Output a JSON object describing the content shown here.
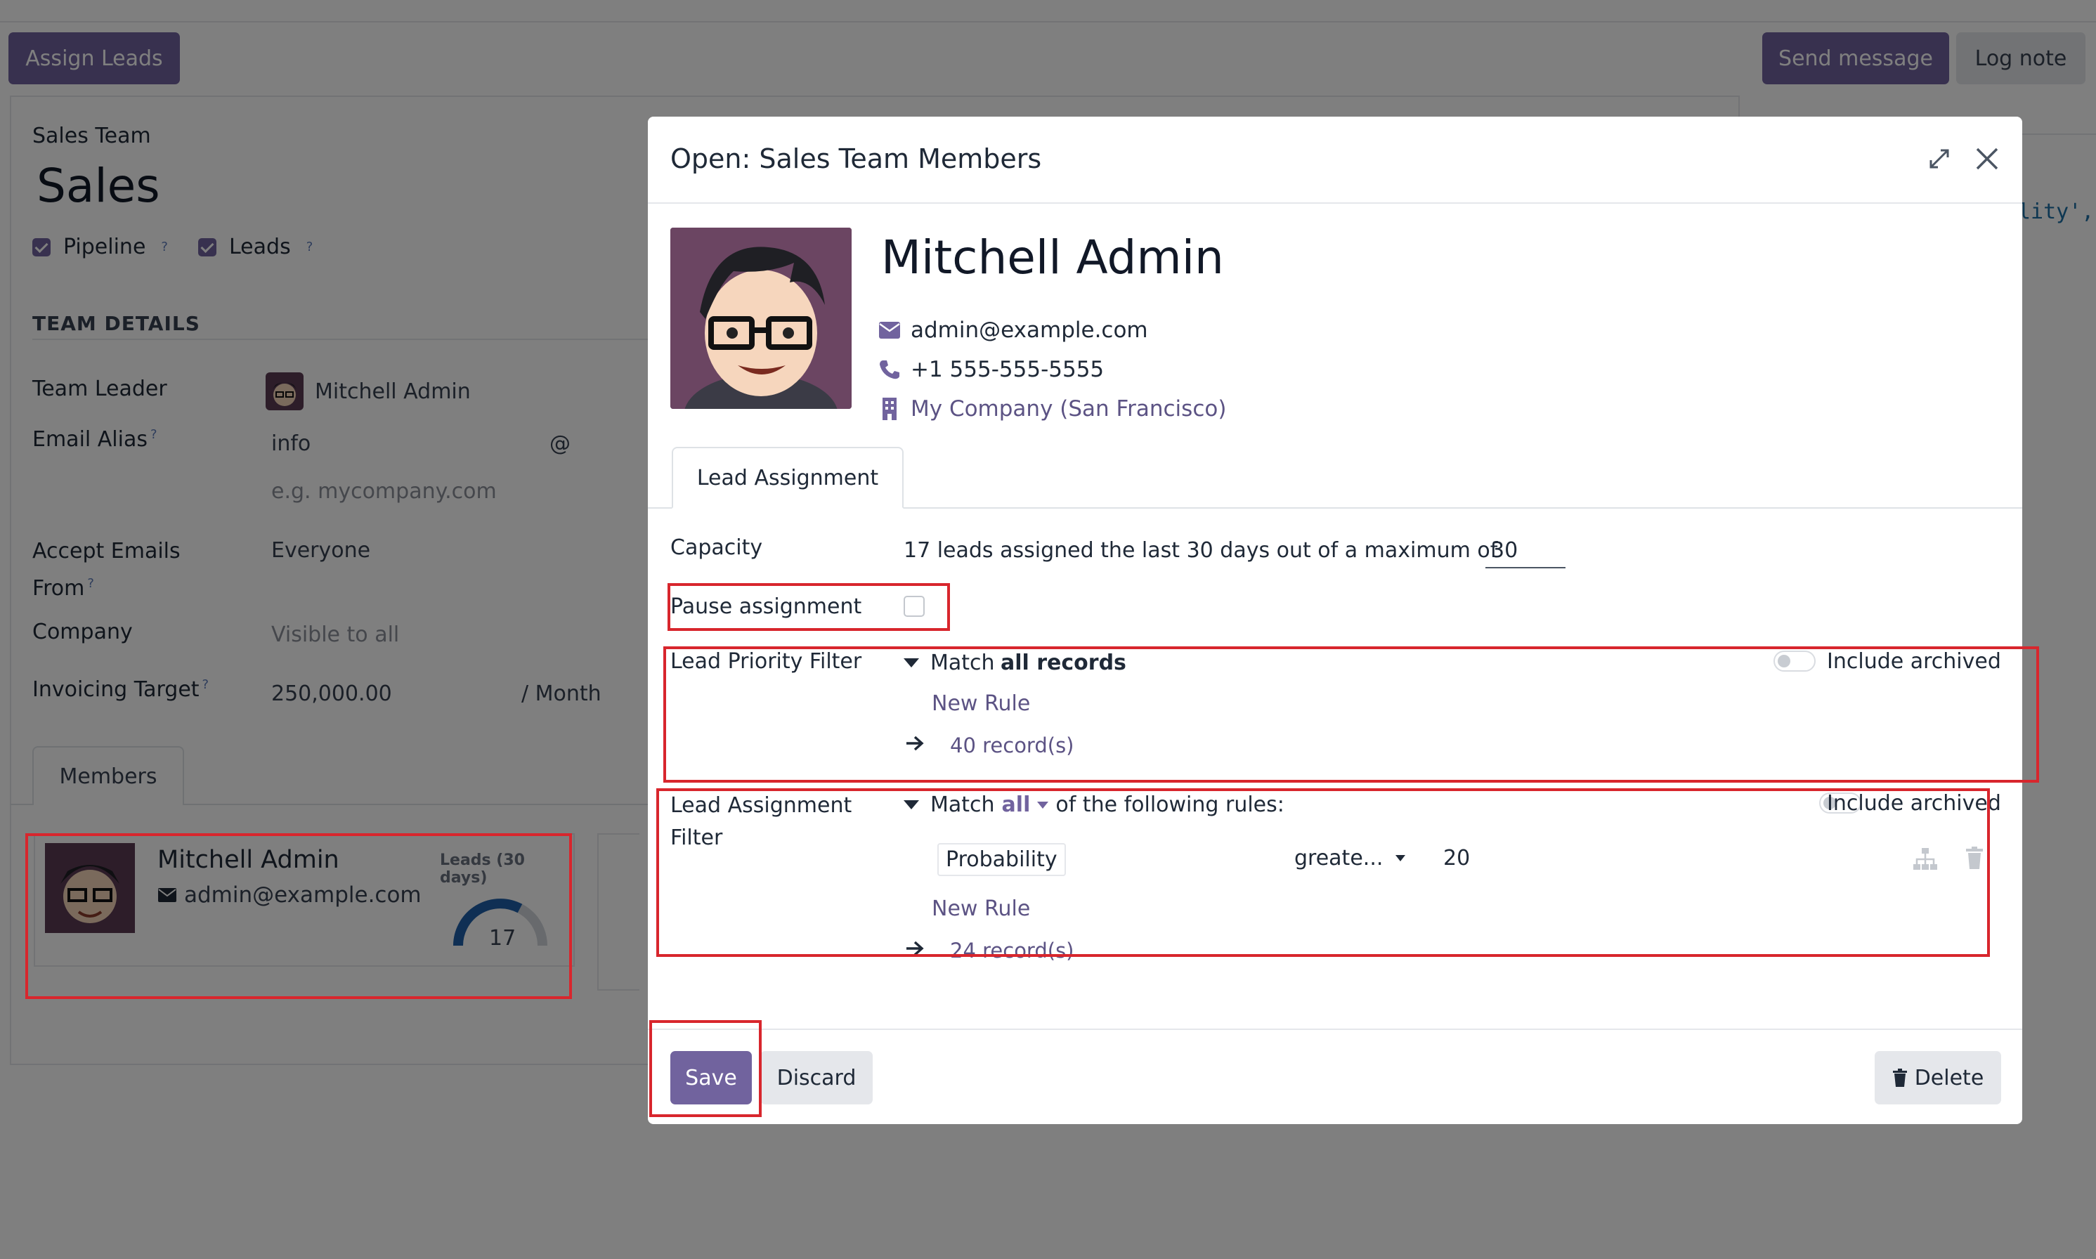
{
  "background": {
    "assign_leads": "Assign Leads",
    "send_message": "Send message",
    "log_note": "Log note",
    "team_label": "Sales Team",
    "team_name": "Sales",
    "pipeline": "Pipeline",
    "leads": "Leads",
    "section_title": "TEAM DETAILS",
    "fields": {
      "team_leader_label": "Team Leader",
      "team_leader_value": "Mitchell Admin",
      "email_alias_label": "Email Alias",
      "email_alias_value": "info",
      "email_alias_at": "@",
      "domain_placeholder": "e.g. mycompany.com",
      "accept_emails_label_1": "Accept Emails",
      "accept_emails_label_2": "From",
      "accept_emails_value": "Everyone",
      "company_label": "Company",
      "company_placeholder": "Visible to all",
      "invoicing_label": "Invoicing Target",
      "invoicing_value": "250,000.00",
      "invoicing_period": "/ Month"
    },
    "members_tab": "Members",
    "member_card": {
      "name": "Mitchell Admin",
      "email": "admin@example.com",
      "leads_label": "Leads (30 days)",
      "leads_count": "17"
    },
    "right_snippet": "lity', '>="
  },
  "dialog": {
    "title": "Open: Sales Team Members",
    "name": "Mitchell Admin",
    "email": "admin@example.com",
    "phone": "+1 555-555-5555",
    "company": "My Company (San Francisco)",
    "tab": "Lead Assignment",
    "capacity_label": "Capacity",
    "capacity_text": "17 leads assigned the last 30 days out of a maximum of",
    "capacity_value": "30",
    "pause_label": "Pause assignment",
    "priority_label": "Lead Priority Filter",
    "match_prefix": "Match",
    "match_all_records": "all records",
    "include_archived": "Include archived",
    "new_rule": "New Rule",
    "priority_records": "40 record(s)",
    "assignment_label_1": "Lead Assignment",
    "assignment_label_2": "Filter",
    "match_all": "all",
    "match_suffix": "of the following rules:",
    "rule_field": "Probability",
    "rule_operator": "greate...",
    "rule_value": "20",
    "assignment_records": "24 record(s)",
    "save": "Save",
    "discard": "Discard",
    "delete": "Delete"
  },
  "colors": {
    "primary": "#71639e",
    "highlight": "#d8262d",
    "link": "#5c5384"
  }
}
